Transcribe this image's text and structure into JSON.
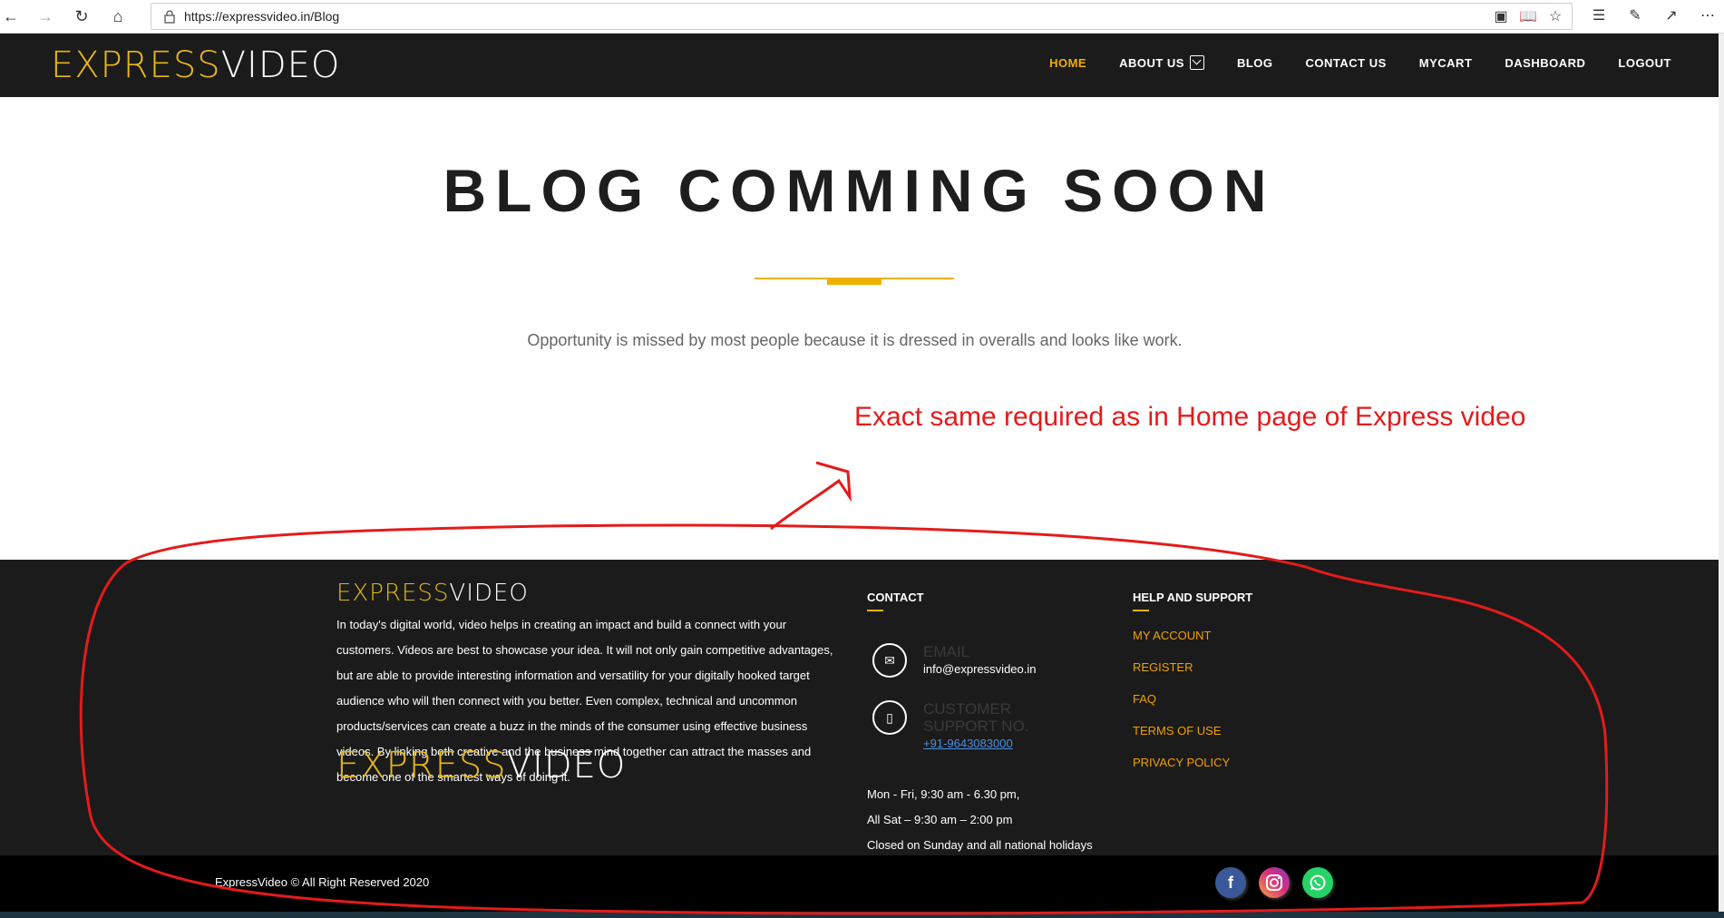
{
  "browser": {
    "url": "https://expressvideo.in/Blog"
  },
  "nav": {
    "logo_part1": "EXPRESS",
    "logo_part2": "VIDEO",
    "items": [
      {
        "label": "HOME",
        "active": true
      },
      {
        "label": "ABOUT US",
        "has_dropdown": true
      },
      {
        "label": "BLOG"
      },
      {
        "label": "CONTACT US"
      },
      {
        "label": "MYCART"
      },
      {
        "label": "DASHBOARD"
      },
      {
        "label": "LOGOUT"
      }
    ]
  },
  "hero": {
    "title": "BLOG COMMING SOON",
    "quote": "Opportunity is missed by most people because it is dressed in overalls and looks like work."
  },
  "annotation": {
    "text": "Exact same required as in Home page of Express video",
    "color": "#e41b1b"
  },
  "footer": {
    "logo_part1": "EXPRESS",
    "logo_part2": "VIDEO",
    "about": "In today's digital world, video helps in creating an impact and build a connect with your customers. Videos are best to showcase your idea. It will not only gain competitive advantages, but are able to provide interesting information and versatility for your digitally hooked target audience who will then connect with you better. Even complex, technical and uncommon products/services can create a buzz in the minds of the consumer using effective business videos. By linking both creative and the business mind together can attract the masses and become one of the smartest ways of doing it.",
    "contact_heading": "CONTACT",
    "email_label": "EMAIL",
    "email_value": "info@expressvideo.in",
    "support_label": "CUSTOMER SUPPORT NO.",
    "support_value": "+91-9643083000",
    "hours_line1": "Mon - Fri, 9:30 am - 6.30 pm,",
    "hours_line2": "All Sat – 9:30 am – 2:00 pm",
    "hours_line3": "Closed on Sunday and all national holidays",
    "help_heading": "HELP AND SUPPORT",
    "help_links": [
      "MY ACCOUNT",
      "REGISTER",
      "FAQ",
      "TERMS OF USE",
      "PRIVACY POLICY"
    ],
    "copyright": "ExpressVideo © All Right Reserved 2020",
    "socials": [
      "facebook-icon",
      "instagram-icon",
      "whatsapp-icon"
    ]
  },
  "colors": {
    "accent": "#f0b000",
    "dark_bg": "#1b1b1b"
  }
}
